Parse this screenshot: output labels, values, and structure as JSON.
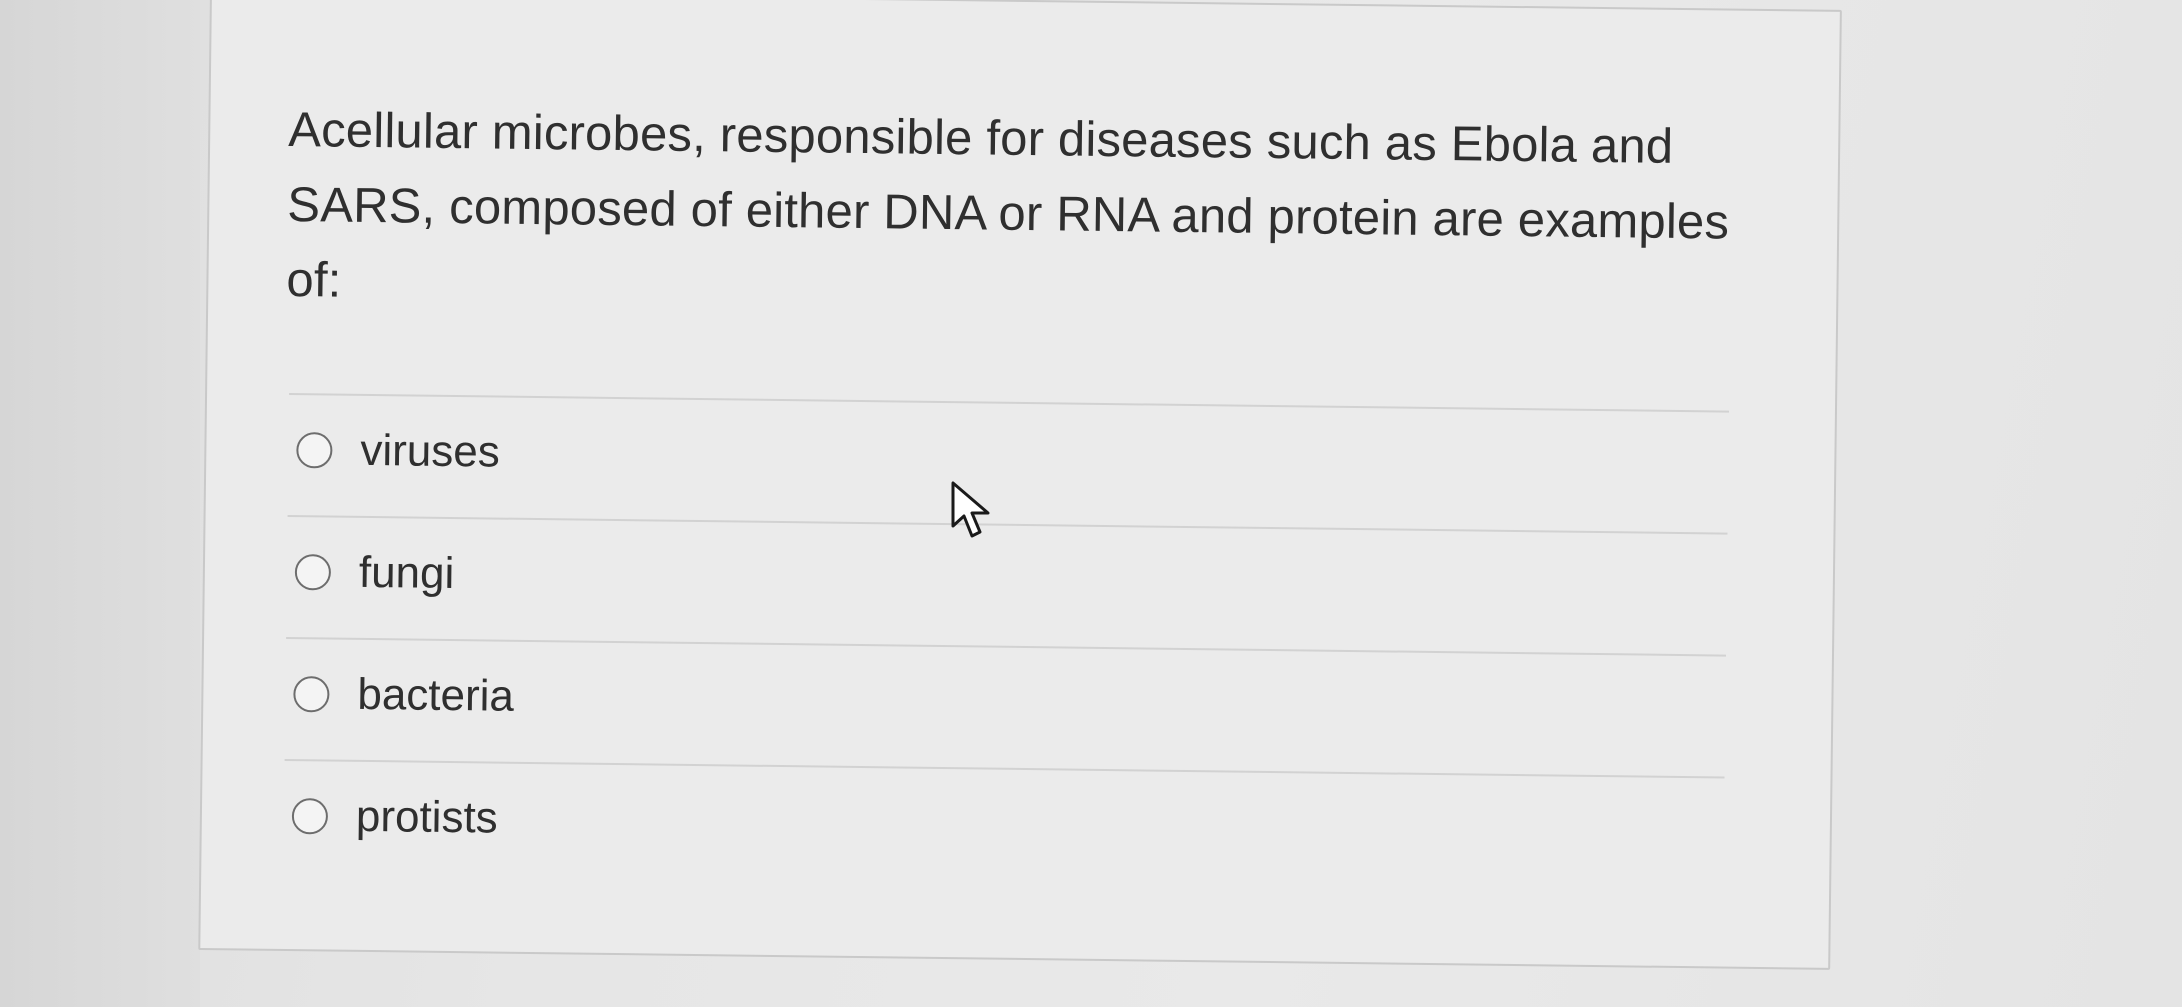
{
  "question": {
    "text": "Acellular microbes, responsible for diseases such as Ebola and SARS, composed of either DNA or RNA and protein are examples of:"
  },
  "options": [
    {
      "label": "viruses",
      "selected": false
    },
    {
      "label": "fungi",
      "selected": false
    },
    {
      "label": "bacteria",
      "selected": false
    },
    {
      "label": "protists",
      "selected": false
    }
  ],
  "icons": {
    "radio": "radio-unselected-icon",
    "cursor": "mouse-pointer-icon"
  },
  "colors": {
    "card_background": "#ebebeb",
    "text": "#2f2f2f",
    "divider": "#d2d2d2",
    "radio_border": "#6d6d6d"
  }
}
